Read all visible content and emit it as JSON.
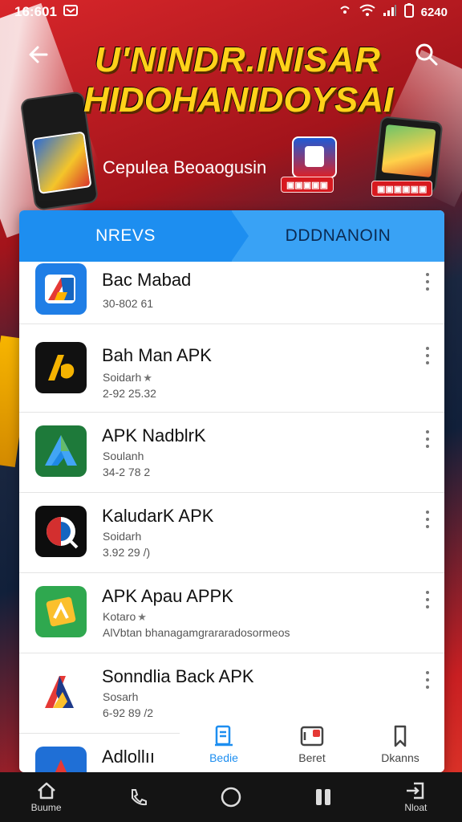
{
  "status_bar": {
    "time": "16:601",
    "battery": "6240"
  },
  "banner": {
    "title_line1": "U'NINDR.INISAR",
    "title_line2": "HIDOHANIDOYSAI",
    "subtitle": "Cepulea Beoaogusin",
    "badge_left": "▣▣▣▣▣",
    "badge_right": "▣▣▣▣▣▣"
  },
  "tabs": [
    {
      "label": "NREVS"
    },
    {
      "label": "DDDNANOIN"
    }
  ],
  "apps": [
    {
      "name": "Bac Mabad",
      "line1": "30-802 61",
      "line2": ""
    },
    {
      "name": "Bah Man APK",
      "line1": "Soidarh",
      "line2": "2-92 25.32"
    },
    {
      "name": "APK NadblrK",
      "line1": "Soulanh",
      "line2": "34-2 78 2"
    },
    {
      "name": "KaludarK APK",
      "line1": "Soidarh",
      "line2": "3.92 29 /)"
    },
    {
      "name": "APK Apau APPK",
      "line1": "Kotaro",
      "line2": "AlVbtan bhanagamgrararadosormeos"
    },
    {
      "name": "Sonndlia Back APK",
      "line1": "Sosarh",
      "line2": "6-92 89 /2"
    },
    {
      "name": "Adlollıı",
      "line1": "",
      "line2": ""
    }
  ],
  "card_nav": [
    {
      "label": "Bedie",
      "icon": "document-icon"
    },
    {
      "label": "Beret",
      "icon": "app-window-icon"
    },
    {
      "label": "Dkanns",
      "icon": "bookmark-icon"
    }
  ],
  "system_nav": [
    {
      "label": "Buume",
      "icon": "home-icon"
    },
    {
      "label": "",
      "icon": "phone-icon"
    },
    {
      "label": "",
      "icon": "circle-home-icon"
    },
    {
      "label": "",
      "icon": "pause-icon"
    },
    {
      "label": "Nloat",
      "icon": "login-icon"
    }
  ],
  "colors": {
    "accent": "#1d8ef0",
    "banner_yellow": "#ffd21a",
    "brand_red": "#d7191f"
  }
}
